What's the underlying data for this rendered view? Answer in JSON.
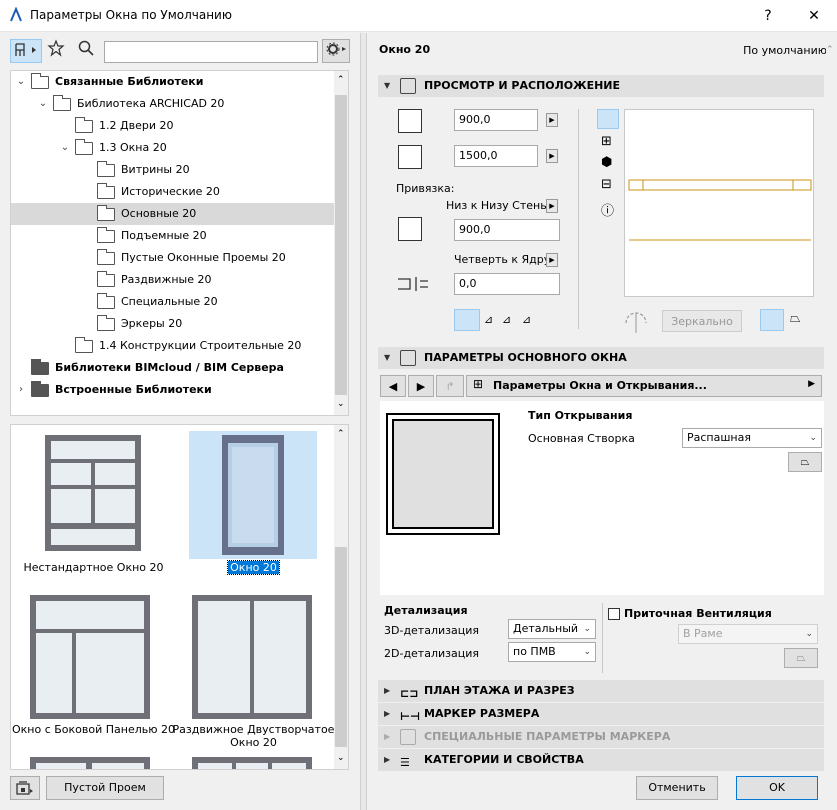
{
  "window": {
    "title": "Параметры Окна по Умолчанию",
    "help": "?",
    "close": "✕"
  },
  "left": {
    "search": {
      "value": "",
      "placeholder": ""
    },
    "tree": [
      {
        "label": "Связанные Библиотеки",
        "indent": 0,
        "expanded": true,
        "bold": true,
        "selected": false
      },
      {
        "label": "Библиотека ARCHICAD 20",
        "indent": 1,
        "expanded": true,
        "bold": false,
        "selected": false
      },
      {
        "label": "1.2 Двери 20",
        "indent": 2,
        "expanded": null,
        "bold": false,
        "selected": false
      },
      {
        "label": "1.3 Окна 20",
        "indent": 2,
        "expanded": true,
        "bold": false,
        "selected": false
      },
      {
        "label": "Витрины 20",
        "indent": 3,
        "expanded": null,
        "bold": false,
        "selected": false
      },
      {
        "label": "Исторические 20",
        "indent": 3,
        "expanded": null,
        "bold": false,
        "selected": false
      },
      {
        "label": "Основные 20",
        "indent": 3,
        "expanded": null,
        "bold": false,
        "selected": true
      },
      {
        "label": "Подъемные 20",
        "indent": 3,
        "expanded": null,
        "bold": false,
        "selected": false
      },
      {
        "label": "Пустые Оконные Проемы 20",
        "indent": 3,
        "expanded": null,
        "bold": false,
        "selected": false
      },
      {
        "label": "Раздвижные 20",
        "indent": 3,
        "expanded": null,
        "bold": false,
        "selected": false
      },
      {
        "label": "Специальные 20",
        "indent": 3,
        "expanded": null,
        "bold": false,
        "selected": false
      },
      {
        "label": "Эркеры 20",
        "indent": 3,
        "expanded": null,
        "bold": false,
        "selected": false
      },
      {
        "label": "1.4 Конструкции Строительные 20",
        "indent": 2,
        "expanded": null,
        "bold": false,
        "selected": false
      },
      {
        "label": "Библиотеки BIMcloud / BIM Сервера",
        "indent": 0,
        "expanded": null,
        "bold": true,
        "selected": false
      },
      {
        "label": "Встроенные Библиотеки",
        "indent": 0,
        "expanded": false,
        "bold": true,
        "selected": false
      }
    ],
    "thumbs": [
      {
        "label": "Нестандартное Окно 20",
        "selected": false
      },
      {
        "label": "Окно 20",
        "selected": true
      },
      {
        "label": "Окно с Боковой Панелью 20",
        "selected": false
      },
      {
        "label": "Раздвижное Двустворчатое Окно 20",
        "selected": false
      }
    ],
    "empty_opening_button": "Пустой Проем"
  },
  "right": {
    "object_name": "Окно 20",
    "default_label": "По умолчанию",
    "sections": {
      "preview": "ПРОСМОТР И РАСПОЛОЖЕНИЕ",
      "main_params": "ПАРАМЕТРЫ ОСНОВНОГО ОКНА",
      "plan": "ПЛАН ЭТАЖА И РАЗРЕЗ",
      "dimension": "МАРКЕР РАЗМЕРА",
      "special": "СПЕЦИАЛЬНЫЕ ПАРАМЕТРЫ МАРКЕРА",
      "categories": "КАТЕГОРИИ И СВОЙСТВА"
    },
    "width": "900,0",
    "height": "1500,0",
    "anchor_label": "Привязка:",
    "anchor_mode": "Низ к Низу Стены",
    "sill": "900,0",
    "reveal_mode": "Четверть к Ядру",
    "reveal": "0,0",
    "mirror_button": "Зеркально",
    "page_selector": "Параметры Окна и Открывания...",
    "opening_type_title": "Тип Открывания",
    "main_sash_label": "Основная Створка",
    "main_sash_value": "Распашная",
    "detail_title": "Детализация",
    "detail_3d_label": "3D-детализация",
    "detail_3d_value": "Детальный",
    "detail_2d_label": "2D-детализация",
    "detail_2d_value": "по ПМВ",
    "vent_label": "Приточная Вентиляция",
    "vent_position": "В Раме",
    "cancel": "Отменить",
    "ok": "OK"
  }
}
